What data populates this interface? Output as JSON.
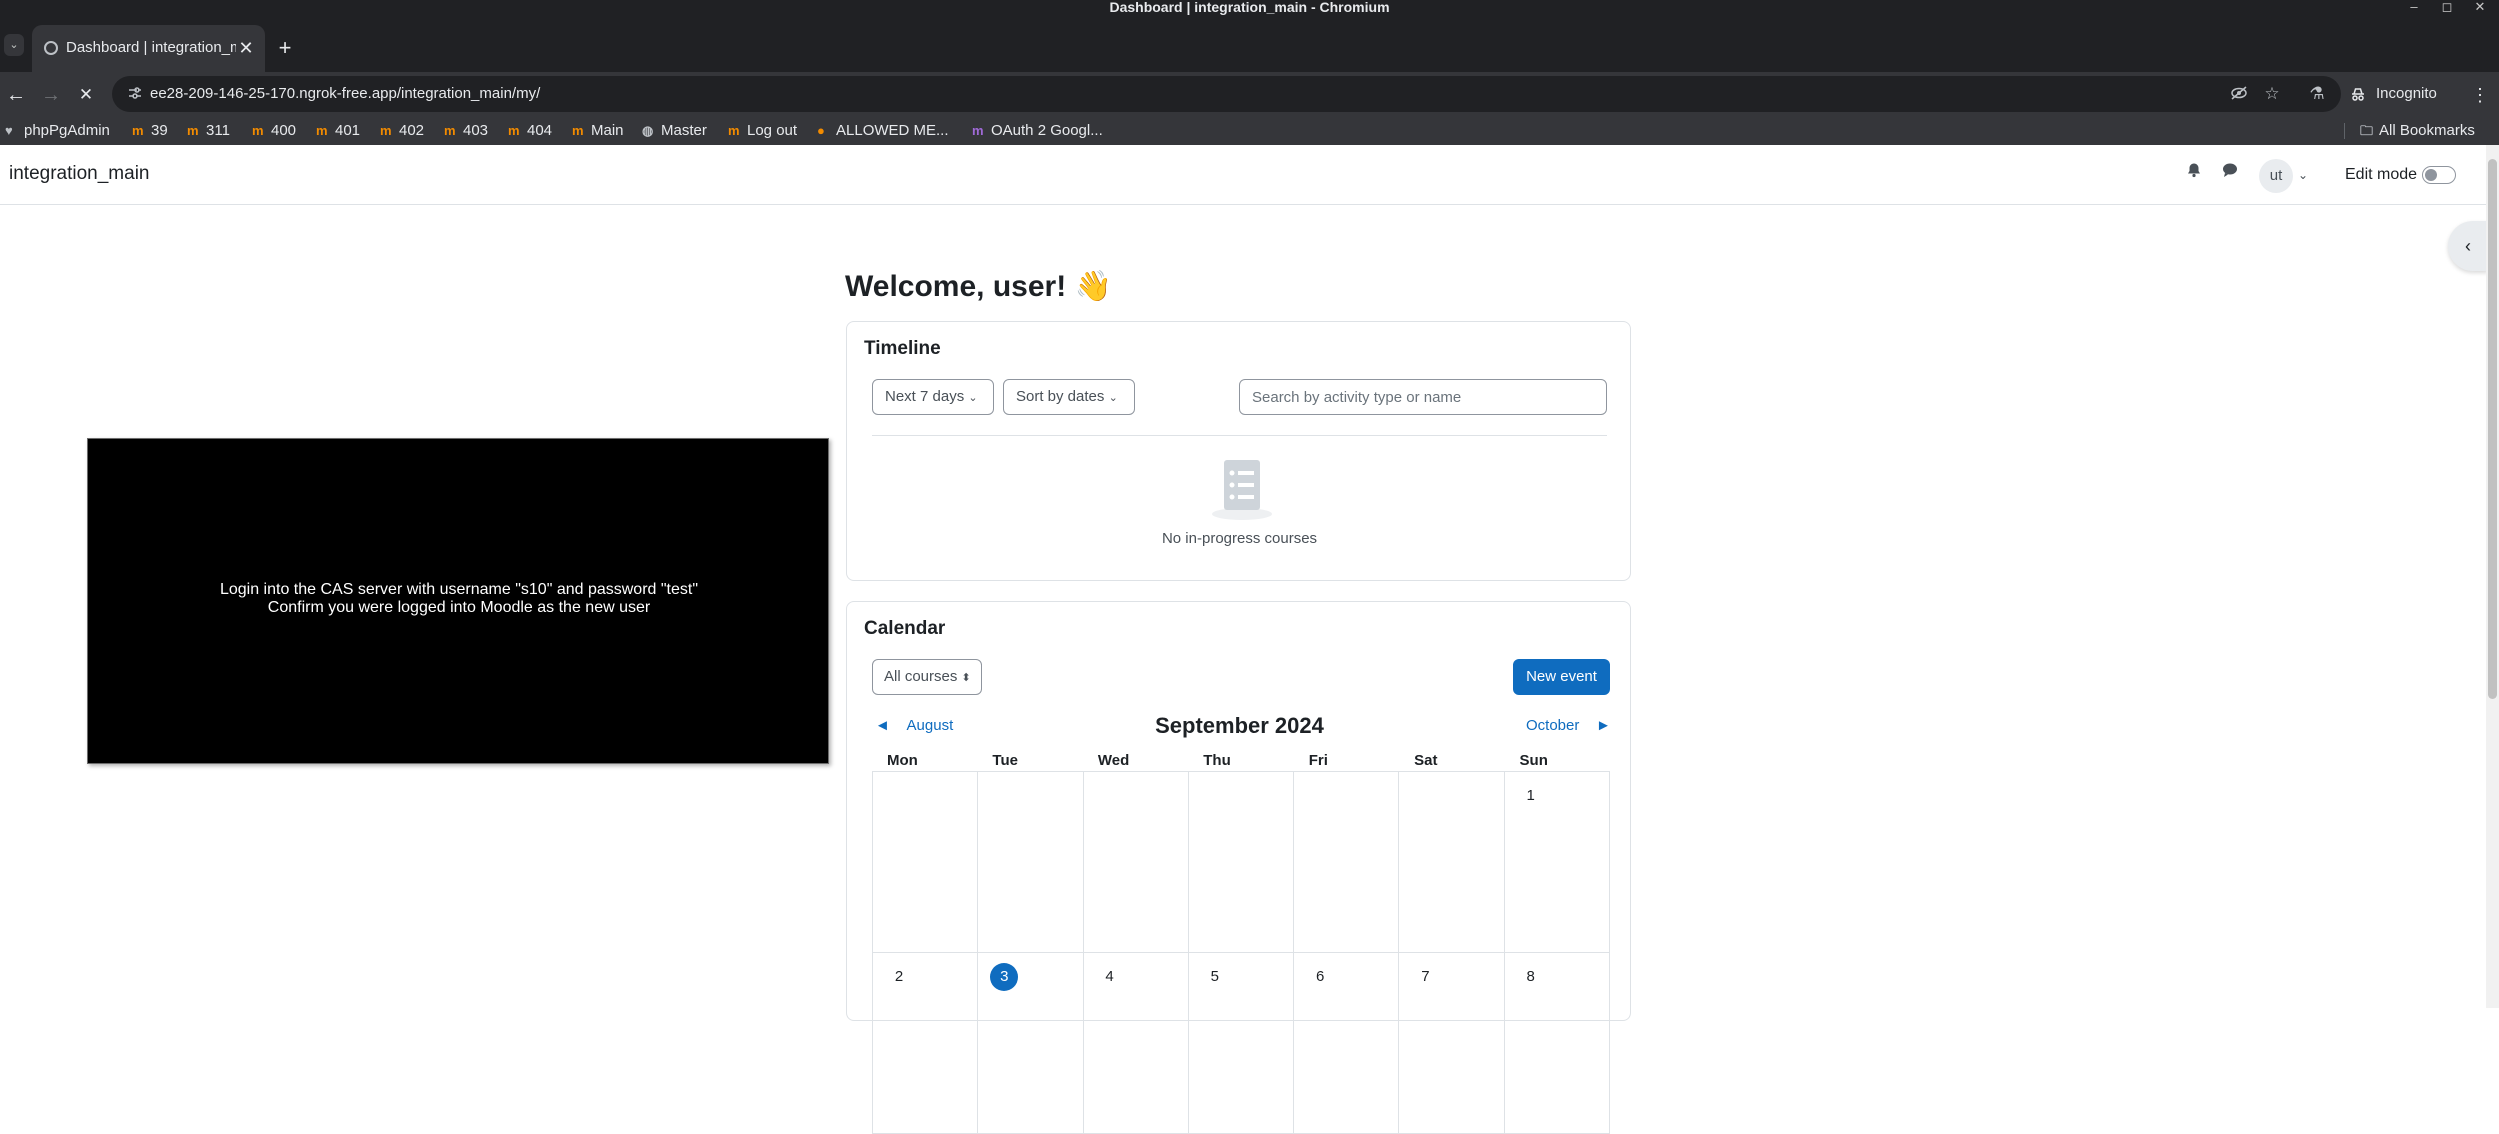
{
  "window": {
    "title": "Dashboard | integration_main - Chromium",
    "minimize": "–",
    "restore": "◻",
    "close": "✕"
  },
  "tabs": {
    "menu_icon": "⌄",
    "active": {
      "title": "Dashboard | integration_main",
      "close": "✕"
    },
    "new_tab": "+"
  },
  "toolbar": {
    "back": "←",
    "forward": "→",
    "reload": "✕",
    "url": "ee28-209-146-25-170.ngrok-free.app/integration_main/my/",
    "incognito_label": "Incognito",
    "menu": "⋮"
  },
  "bookmarks": [
    {
      "label": "phpPgAdmin",
      "icon": "elephant-icon"
    },
    {
      "label": "39",
      "icon": "moodle-icon"
    },
    {
      "label": "311",
      "icon": "moodle-icon"
    },
    {
      "label": "400",
      "icon": "moodle-icon"
    },
    {
      "label": "401",
      "icon": "moodle-icon"
    },
    {
      "label": "402",
      "icon": "moodle-icon"
    },
    {
      "label": "403",
      "icon": "moodle-icon"
    },
    {
      "label": "404",
      "icon": "moodle-icon"
    },
    {
      "label": "Main",
      "icon": "moodle-icon"
    },
    {
      "label": "Master",
      "icon": "globe-icon"
    },
    {
      "label": "Log out",
      "icon": "moodle-icon"
    },
    {
      "label": "ALLOWED ME...",
      "icon": "firefox-icon"
    },
    {
      "label": "OAuth 2 Googl...",
      "icon": "moodle-purple-icon"
    }
  ],
  "all_bookmarks": "All Bookmarks",
  "navbar": {
    "site_name": "integration_main",
    "avatar_initials": "ut",
    "edit_mode": "Edit mode"
  },
  "welcome": "Welcome, user! 👋",
  "timeline": {
    "title": "Timeline",
    "filter_label": "Next 7 days",
    "sort_label": "Sort by dates",
    "search_placeholder": "Search by activity type or name",
    "empty_text": "No in-progress courses"
  },
  "calendar": {
    "title": "Calendar",
    "course_filter": "All courses",
    "new_event": "New event",
    "prev_month": "August",
    "month": "September 2024",
    "next_month": "October",
    "weekdays": [
      "Mon",
      "Tue",
      "Wed",
      "Thu",
      "Fri",
      "Sat",
      "Sun"
    ],
    "week1": [
      "",
      "",
      "",
      "",
      "",
      "",
      "1"
    ],
    "week2": [
      "2",
      "3",
      "4",
      "5",
      "6",
      "7",
      "8"
    ],
    "today": "3"
  },
  "overlay": {
    "line1": "Login into the CAS server with username \"s10\" and password \"test\"",
    "line2": "Confirm you were logged into Moodle as the new user"
  },
  "colors": {
    "accent": "#0f6cbf",
    "bookmark_icon": "#f28b00",
    "chrome_dark": "#202124",
    "chrome_mid": "#35363a"
  }
}
